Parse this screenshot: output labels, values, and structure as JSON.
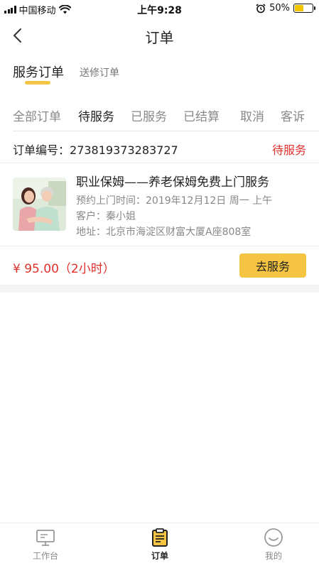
{
  "status_bar": {
    "carrier": "中国移动",
    "time": "上午9:28",
    "battery": "50%",
    "battery_level": 0.5
  },
  "nav": {
    "title": "订单",
    "back_icon": "chevron-left-icon"
  },
  "order_types": [
    {
      "label": "服务订单",
      "active": true
    },
    {
      "label": "送修订单",
      "active": false
    }
  ],
  "status_tabs": [
    {
      "label": "全部订单",
      "active": false
    },
    {
      "label": "待服务",
      "active": true
    },
    {
      "label": "已服务",
      "active": false
    },
    {
      "label": "已结算",
      "active": false
    },
    {
      "label": "取消",
      "active": false
    },
    {
      "label": "客诉",
      "active": false
    }
  ],
  "order": {
    "number_label": "订单编号：",
    "number": "273819373283727",
    "status": "待服务",
    "service_title": "职业保姆——养老保姆免费上门服务",
    "appointment": "预约上门时间：2019年12月12日 周一 上午",
    "customer": "客户：秦小姐",
    "address": "地址：北京市海淀区财富大厦A座808室",
    "price": "¥ 95.00（2小时）",
    "action_label": "去服务"
  },
  "tabbar": [
    {
      "label": "工作台",
      "icon": "monitor-icon",
      "active": false
    },
    {
      "label": "订单",
      "icon": "clipboard-icon",
      "active": true
    },
    {
      "label": "我的",
      "icon": "smile-icon",
      "active": false
    }
  ],
  "colors": {
    "accent": "#f6c443",
    "status_red": "#e0302c"
  }
}
